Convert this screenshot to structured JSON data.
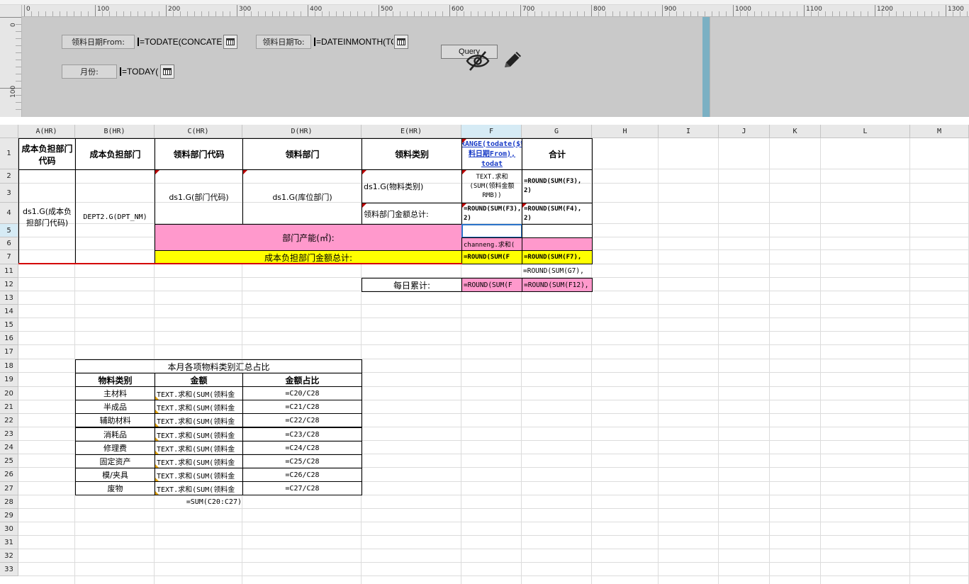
{
  "ruler": {
    "labels": [
      "0",
      "100",
      "200",
      "300",
      "400",
      "500",
      "600",
      "700",
      "800",
      "900",
      "1000",
      "1100",
      "1200",
      "1300"
    ],
    "vlabels": [
      "0",
      "100"
    ]
  },
  "params": {
    "from_label": "领料日期From:",
    "from_value": "=TODATE(CONCATE",
    "to_label": "领料日期To:",
    "to_value": "=DATEINMONTH(TO",
    "month_label": "月份:",
    "month_value": "=TODAY(",
    "query_label": "Query"
  },
  "icons": {
    "calendar": "calendar-icon",
    "hide": "eye-slash-icon",
    "edit": "pencil-icon"
  },
  "columns": [
    "A(HR)",
    "B(HR)",
    "C(HR)",
    "D(HR)",
    "E(HR)",
    "F",
    "G",
    "H",
    "I",
    "J",
    "K",
    "L",
    "M"
  ],
  "rows": [
    "1",
    "2",
    "3",
    "4",
    "5",
    "6",
    "7",
    "11",
    "12",
    "13",
    "14",
    "15",
    "16",
    "17",
    "18",
    "19",
    "20",
    "21",
    "22",
    "23",
    "24",
    "25",
    "26",
    "27",
    "28",
    "29",
    "30",
    "31",
    "32",
    "33"
  ],
  "report": {
    "a1": "成本负担部门代码",
    "b1": "成本负担部门",
    "c1": "领料部门代码",
    "d1": "领料部门",
    "e1": "领料类别",
    "f1": "=RANGE(todate($领料日期From), todat",
    "g1": "合计",
    "a2": "ds1.G(成本负担部门代码)",
    "b2": "DEPT2.G(DPT_NM)",
    "c2": "ds1.G(部门代码)",
    "d2": "ds1.G(库位部门)",
    "e2": "ds1.G(物料类别)",
    "f2": "TEXT.求和(SUM(领料金额RMB))",
    "g2": "=ROUND(SUM(F3), 2)",
    "e4": "领料部门金额总计:",
    "f4": "=ROUND(SUM(F3), 2)",
    "g4": "=ROUND(SUM(F4), 2)",
    "c5": "部门产能(㎡):",
    "f6": "channeng.求和(",
    "c7": "成本负担部门金额总计:",
    "f7": "=ROUND(SUM(F",
    "g7": "=ROUND(SUM(F7),",
    "g11": "=ROUND(SUM(G7),",
    "e12": "每日累计:",
    "f12": "=ROUND(SUM(F",
    "g12": "=ROUND(SUM(F12),"
  },
  "summary": {
    "title": "本月各项物料类别汇总占比",
    "headers": [
      "物料类别",
      "金额",
      "金额占比"
    ],
    "rows": [
      {
        "cat": "主材料",
        "amt": "TEXT.求和(SUM(领料金",
        "pct": "=C20/C28"
      },
      {
        "cat": "半成品",
        "amt": "TEXT.求和(SUM(领料金",
        "pct": "=C21/C28"
      },
      {
        "cat": "辅助材料",
        "amt": "TEXT.求和(SUM(领料金",
        "pct": "=C22/C28"
      },
      {
        "cat": "消耗品",
        "amt": "TEXT.求和(SUM(领料金",
        "pct": "=C23/C28"
      },
      {
        "cat": "修理费",
        "amt": "TEXT.求和(SUM(领料金",
        "pct": "=C24/C28"
      },
      {
        "cat": "固定资产",
        "amt": "TEXT.求和(SUM(领料金",
        "pct": "=C25/C28"
      },
      {
        "cat": "模/夹具",
        "amt": "TEXT.求和(SUM(领料金",
        "pct": "=C26/C28"
      },
      {
        "cat": "废物",
        "amt": "TEXT.求和(SUM(领料金",
        "pct": "=C27/C28"
      }
    ],
    "total": "=SUM(C20:C27)"
  }
}
